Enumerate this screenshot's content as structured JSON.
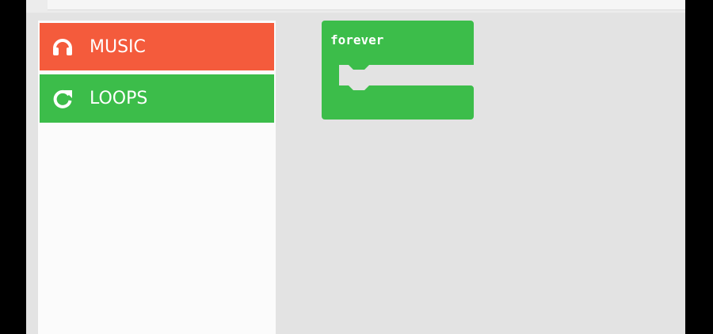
{
  "toolbox": {
    "categories": [
      {
        "label": "MUSIC",
        "icon": "headphones-icon",
        "color": "#f45b3c"
      },
      {
        "label": "LOOPS",
        "icon": "refresh-icon",
        "color": "#3cbd4a"
      }
    ]
  },
  "workspace": {
    "blocks": [
      {
        "label": "forever",
        "color": "#3cbd4a"
      }
    ]
  }
}
